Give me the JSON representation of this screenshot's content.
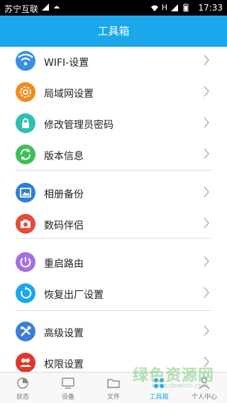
{
  "statusbar": {
    "carrier": "苏宁互联",
    "network": "H",
    "time": "17:33"
  },
  "title": "工具箱",
  "items": [
    {
      "label": "WIFI-设置",
      "color": "#3a8ee6",
      "icon": "wifi-icon"
    },
    {
      "label": "局域网设置",
      "color": "#f28a1f",
      "icon": "gear-icon"
    },
    {
      "label": "修改管理员密码",
      "color": "#2ebfb0",
      "icon": "lock-icon"
    },
    {
      "label": "版本信息",
      "color": "#3fbf5a",
      "icon": "refresh-icon"
    },
    {
      "label": "相册备份",
      "color": "#2e7fd8",
      "icon": "image-icon"
    },
    {
      "label": "数码伴侣",
      "color": "#e84a3c",
      "icon": "camera-icon"
    },
    {
      "label": "重启路由",
      "color": "#a86de0",
      "icon": "power-icon"
    },
    {
      "label": "恢复出厂设置",
      "color": "#1aa7ec",
      "icon": "reset-icon"
    },
    {
      "label": "高级设置",
      "color": "#3a7fd6",
      "icon": "tools-icon"
    },
    {
      "label": "权限设置",
      "color": "#e0362c",
      "icon": "users-icon"
    }
  ],
  "tabs": [
    {
      "label": "状态",
      "icon": "status-icon"
    },
    {
      "label": "设备",
      "icon": "monitor-icon"
    },
    {
      "label": "文件",
      "icon": "folder-icon"
    },
    {
      "label": "工具箱",
      "icon": "toolbox-icon",
      "active": true
    },
    {
      "label": "个人中心",
      "icon": "person-icon"
    }
  ],
  "watermark": "绿色资源网",
  "watermark_url": "www.downcc.com"
}
